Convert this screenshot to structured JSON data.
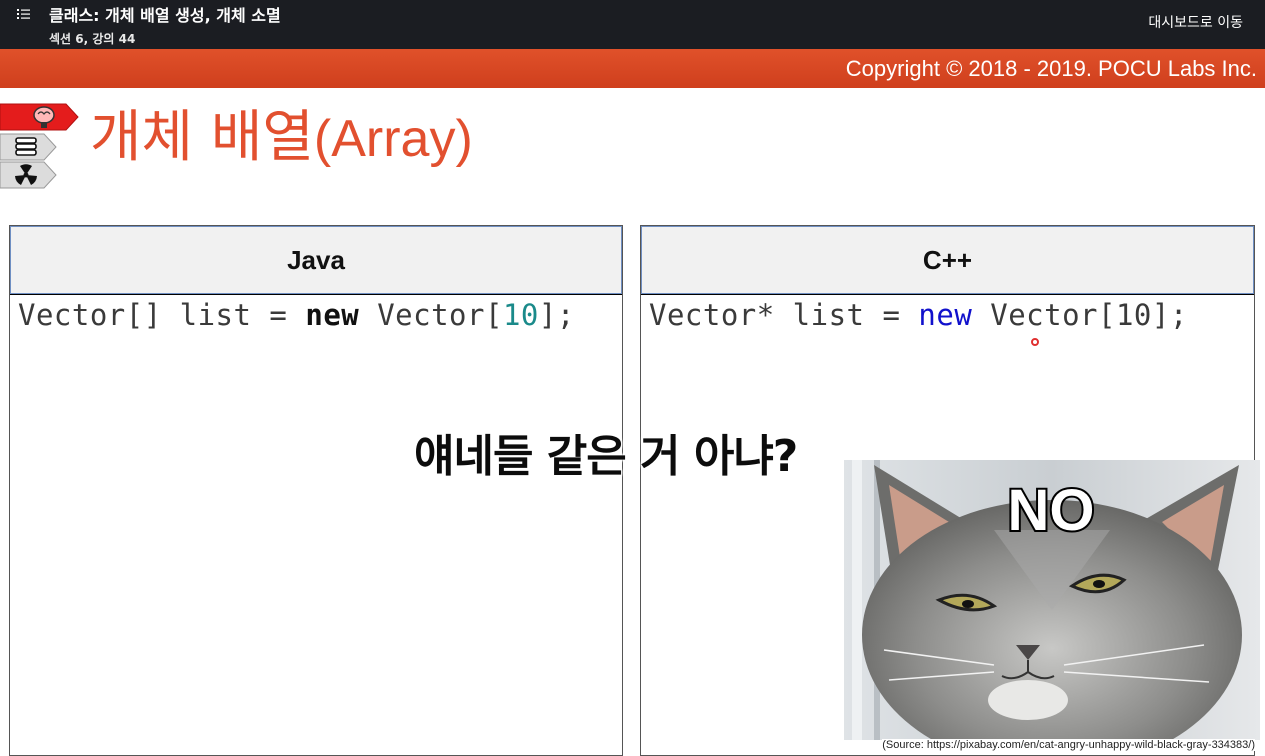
{
  "header": {
    "menu_icon": "list-icon",
    "title": "클래스: 개체 배열 생성, 개체 소멸",
    "subtitle": "섹션 6, 강의 44",
    "dashboard_link": "대시보드로 이동"
  },
  "slide": {
    "copyright": "Copyright © 2018 - 2019. POCU Labs Inc.",
    "title_main": "개체 배열",
    "title_paren": "(Array)",
    "tabs": [
      {
        "icon": "brain-icon",
        "color": "#e02020"
      },
      {
        "icon": "books-icon",
        "color": "#d9d9d9"
      },
      {
        "icon": "radiation-icon",
        "color": "#d9d9d9"
      }
    ],
    "panels": {
      "java": {
        "header": "Java",
        "code": {
          "a": "Vector[] list = ",
          "kw": "new",
          "b": " Vector[",
          "num": "10",
          "c": "];"
        }
      },
      "cpp": {
        "header": "C++",
        "code": {
          "a": "Vector* list = ",
          "kw": "new",
          "b": " Vector[10];"
        }
      }
    },
    "caption": "얘네들 같은 거 아냐?",
    "meme_text": "NO",
    "source": "(Source: https://pixabay.com/en/cat-angry-unhappy-wild-black-gray-334383/)"
  },
  "colors": {
    "accent": "#e2502f",
    "header_bg": "#1b1d22",
    "java_number": "#1a8a8a",
    "cpp_keyword": "#1111cc"
  }
}
